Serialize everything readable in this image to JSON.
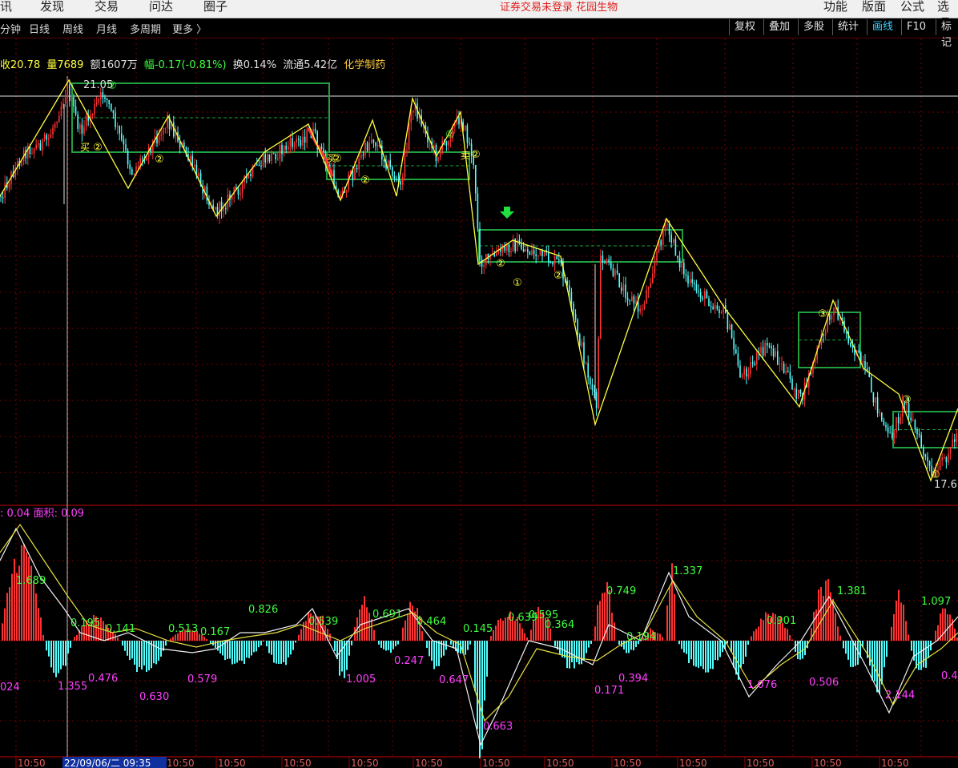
{
  "menubar": {
    "items": [
      "讯",
      "发现",
      "交易",
      "问达",
      "圈子"
    ],
    "notice": "证券交易未登录 花园生物",
    "right_items": [
      "功能",
      "版面",
      "公式",
      "选项"
    ]
  },
  "toolbar": {
    "periods": [
      "分钟",
      "日线",
      "周线",
      "月线",
      "多周期",
      "更多 〉"
    ],
    "buttons": [
      "复权",
      "叠加",
      "多股",
      "统计",
      "画线",
      "F10",
      "标记"
    ],
    "active_button": "画线"
  },
  "quote": {
    "close": "收20.78",
    "volume": "量7689",
    "amount": "额1607万",
    "change": "幅-0.17(-0.81%)",
    "turnover": "换0.14%",
    "float_cap": "流通5.42亿",
    "sector": "化学制药"
  },
  "price_chart": {
    "high_label": "21.05",
    "low_label": "17.6",
    "pivot_marks": [
      "②",
      "①",
      "③"
    ],
    "box_markers": [
      "买",
      "卖"
    ]
  },
  "indicator": {
    "header": ": 0.04 面积: 0.09",
    "labels_up": [
      "1.689",
      "0.195",
      "0.141",
      "0.513",
      "0.167",
      "0.826",
      "0.539",
      "0.691",
      "0.464",
      "0.145",
      "0.639",
      "0.595",
      "0.364",
      "0.749",
      "1.337",
      "0.194",
      "0.901",
      "1.381",
      "1.097"
    ],
    "labels_down": [
      "024",
      "1.355",
      "0.476",
      "0.630",
      "0.579",
      "1.005",
      "0.247",
      "0.647",
      "0.663",
      "0.171",
      "0.394",
      "1.076",
      "0.506",
      "2.144",
      "0.4"
    ]
  },
  "time_axis": {
    "tick_label": "10:50",
    "cursor_label": "22/09/06/二 09:35"
  },
  "colors": {
    "up": "#ff3232",
    "down": "#54ffff",
    "zigzag": "#ffff40",
    "box": "#20a040",
    "grid": "#7a0000",
    "pos_label": "#40ff40",
    "neg_label": "#ff40ff"
  }
}
